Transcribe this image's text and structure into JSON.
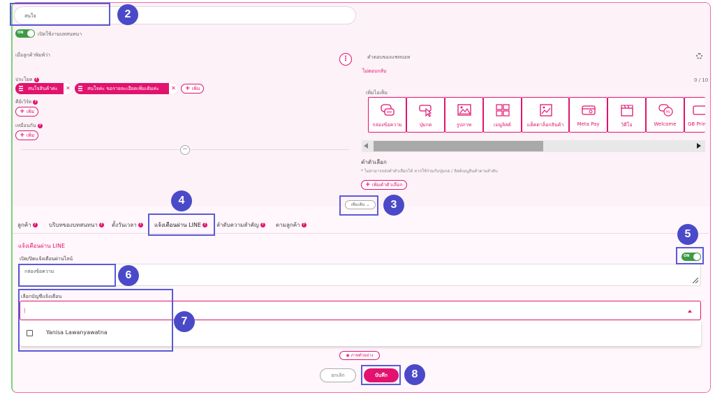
{
  "header": {
    "name_value": "สนใจ",
    "toggle_on_label": "ON",
    "enable_label": "เปิดใช้งานบทสนทนา"
  },
  "trigger": {
    "title": "เมื่อลูกค้าพิมพ์ว่า",
    "sentence_label": "ประโยค",
    "chips": [
      "สนใจสินค้าค่ะ",
      "สนใจค่ะ ขอรายละเอียดเพิ่มเติมค่ะ"
    ],
    "add_label": "เพิ่ม",
    "keyword_label": "คีย์เวิร์ด",
    "similar_label": "เหมือนกัน",
    "collapse_symbol": "−"
  },
  "reply": {
    "title": "คำตอบของแชทบอท",
    "no_reply_label": "ไม่ตอบกลับ",
    "counter": "0 / 10",
    "add_item_label": "เพิ่มไอเท็ม",
    "tiles": [
      {
        "label": "กล่องข้อความ",
        "icon": "message-box-icon"
      },
      {
        "label": "ปุ่มกด",
        "icon": "button-click-icon"
      },
      {
        "label": "รูปภาพ",
        "icon": "image-icon"
      },
      {
        "label": "เมนูลิสต์",
        "icon": "menu-list-icon"
      },
      {
        "label": "แค็ตตาล็อกสินค้า",
        "icon": "catalog-icon"
      },
      {
        "label": "Meta Pay",
        "icon": "meta-pay-icon"
      },
      {
        "label": "วิดีโอ",
        "icon": "video-icon"
      },
      {
        "label": "Welcome",
        "icon": "welcome-icon"
      },
      {
        "label": "GB Prin",
        "icon": "gb-prime-icon"
      }
    ],
    "options_title": "คำตัวเลือก",
    "options_note": "* ไม่สามารถส่งคำตัวเลือกได้ หากใช้ร่วมกับปุ่มกด / ลิสต์เมนูสินค้าตามลำดับ",
    "add_option_label": "เพิ่มคำตัวเลือก",
    "more_label": "เพิ่มเติม ⌄"
  },
  "tabs": [
    "ลูกค้า",
    "บริบทของบทสนทนา",
    "ตั้งวันเวลา",
    "แจ้งเตือนผ่าน LINE",
    "ลำดับความสำคัญ",
    "ตามลูกค้า"
  ],
  "line_notify": {
    "section_title": "แจ้งเตือนผ่าน LINE",
    "toggle_label": "เปิด/ปิดแจ้งเตือนผ่านไลน์",
    "toggle_on_label": "ON",
    "message_placeholder": "กล่องข้อความ",
    "account_label": "เลือกบัญชีแจ้งเตือน",
    "account_input_value": "|",
    "accounts": [
      "Yanisa Lawanyawatna"
    ]
  },
  "footer": {
    "preview_label": "ภาพตัวอย่าง",
    "cancel_label": "ยกเลิก",
    "save_label": "บันทึก"
  },
  "annotations": [
    "2",
    "3",
    "4",
    "5",
    "6",
    "7",
    "8"
  ],
  "colors": {
    "accent": "#e2126e",
    "highlight": "#5a5ad8",
    "badge": "#4a4ac9",
    "toggle_on": "#3d9a46"
  }
}
